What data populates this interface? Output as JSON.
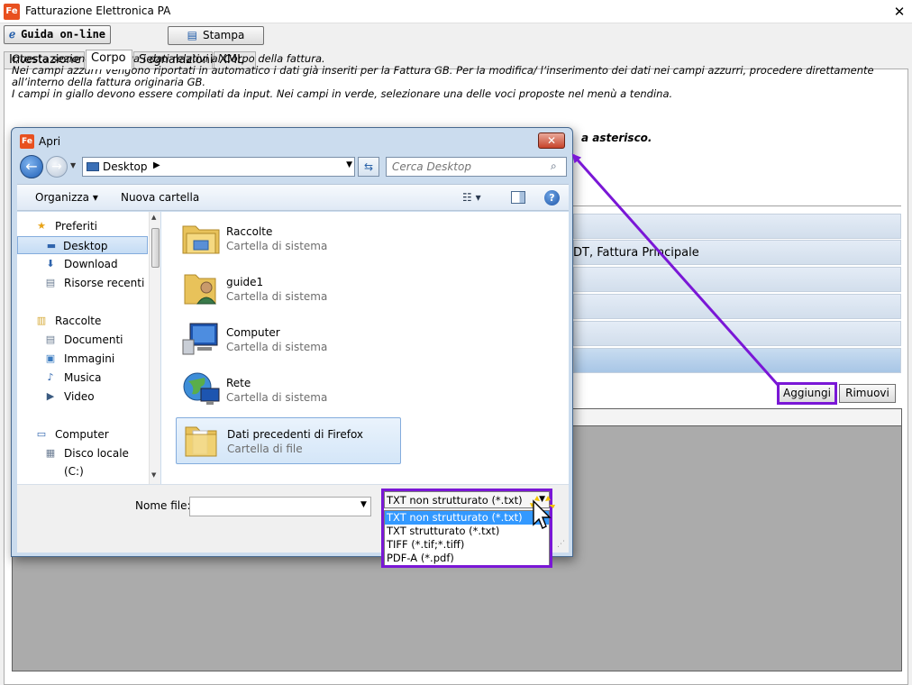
{
  "window": {
    "title": "Fatturazione Elettronica PA",
    "logo_text": "Fe",
    "close_glyph": "✕"
  },
  "toolbar": {
    "guida_label": "Guida on-line",
    "stampa_label": "Stampa"
  },
  "tabs": [
    {
      "label": "Intestazione"
    },
    {
      "label": "Corpo"
    },
    {
      "label": "Segnalazioni"
    },
    {
      "label": "XML"
    }
  ],
  "info": {
    "lines": [
      "Questa sezione riepiloga i dati relativi al Corpo della fattura.",
      "Nei campi azzurri vengono riportati in automatico i dati già inseriti per la Fattura GB. Per la modifica/ l’inserimento dei dati nei campi azzurri, procedere direttamente",
      "all’interno della fattura originaria GB.",
      "I campi in giallo devono essere compilati da input. Nei campi in verde, selezionare una delle voci proposte nel menù a tendina."
    ],
    "bold_fragment": "a asterisco."
  },
  "section_row_text": "DT, Fattura Principale",
  "buttons": {
    "aggiungi": "Aggiungi",
    "rimuovi": "Rimuovi"
  },
  "dialog": {
    "title": "Apri",
    "close_glyph": "✕",
    "address": "Desktop",
    "search_placeholder": "Cerca Desktop",
    "commands": {
      "organizza": "Organizza ▾",
      "nuova_cartella": "Nuova cartella"
    },
    "nav": [
      {
        "label": "Preferiti",
        "icon": "star-icon",
        "glyph": "★"
      },
      {
        "label": "Desktop",
        "icon": "desktop-icon",
        "glyph": "▬"
      },
      {
        "label": "Download",
        "icon": "download-icon",
        "glyph": "⬇"
      },
      {
        "label": "Risorse recenti",
        "icon": "recent-icon",
        "glyph": "▤"
      },
      {
        "label": "Raccolte",
        "icon": "libraries-icon",
        "glyph": "▥"
      },
      {
        "label": "Documenti",
        "icon": "documents-icon",
        "glyph": "▤"
      },
      {
        "label": "Immagini",
        "icon": "pictures-icon",
        "glyph": "▣"
      },
      {
        "label": "Musica",
        "icon": "music-icon",
        "glyph": "♪"
      },
      {
        "label": "Video",
        "icon": "video-icon",
        "glyph": "▶"
      },
      {
        "label": "Computer",
        "icon": "computer-icon",
        "glyph": "▭"
      },
      {
        "label": "Disco locale (C:)",
        "icon": "disk-icon",
        "glyph": "▦"
      }
    ],
    "files": [
      {
        "name": "Raccolte",
        "type": "Cartella di sistema",
        "icon": "libraries-folder-icon"
      },
      {
        "name": "guide1",
        "type": "Cartella di sistema",
        "icon": "user-folder-icon"
      },
      {
        "name": "Computer",
        "type": "Cartella di sistema",
        "icon": "computer-icon"
      },
      {
        "name": "Rete",
        "type": "Cartella di sistema",
        "icon": "network-icon"
      },
      {
        "name": "Dati precedenti di Firefox",
        "type": "Cartella di file",
        "icon": "folder-icon"
      }
    ],
    "filename_label": "Nome file:",
    "filename_value": "",
    "filetype_selected": "TXT non strutturato (*.txt)",
    "filetype_options": [
      "TXT non strutturato (*.txt)",
      "TXT strutturato (*.txt)",
      "TIFF (*.tif;*.tiff)",
      "PDF-A (*.pdf)"
    ]
  },
  "colors": {
    "highlight": "#7a17d6",
    "selection": "#3399ff",
    "accent_blue": "#cbdcee"
  }
}
